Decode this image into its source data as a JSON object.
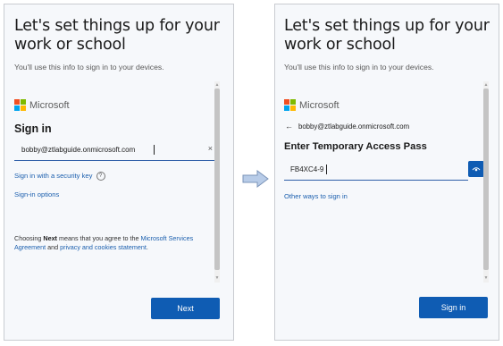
{
  "left_screen": {
    "heading_line1": "Let's set things up for your",
    "heading_line2": "work or school",
    "subtitle": "You'll use this info to sign in to your devices.",
    "brand": "Microsoft",
    "signin_title": "Sign in",
    "email_value": "bobby@ztlabguide.onmicrosoft.com",
    "clear_icon": "×",
    "security_key_link": "Sign in with a security key",
    "help_icon": "?",
    "signin_options_link": "Sign-in options",
    "terms_prefix": "Choosing ",
    "terms_bold": "Next",
    "terms_middle": " means that you agree to the ",
    "terms_link1": "Microsoft Services Agreement",
    "terms_and": " and ",
    "terms_link2": "privacy and cookies statement",
    "terms_end": ".",
    "next_button": "Next"
  },
  "right_screen": {
    "heading_line1": "Let's set things up for your",
    "heading_line2": "work or school",
    "subtitle": "You'll use this info to sign in to your devices.",
    "brand": "Microsoft",
    "back_arrow": "←",
    "account": "bobby@ztlabguide.onmicrosoft.com",
    "tap_title": "Enter Temporary Access Pass",
    "tap_value": "FB4XC4-9",
    "other_ways_link": "Other ways to sign in",
    "signin_button": "Sign in"
  },
  "colors": {
    "accent": "#0f5cb3",
    "link": "#1b5fae",
    "ms_red": "#f25022",
    "ms_green": "#7fba00",
    "ms_blue": "#00a4ef",
    "ms_yellow": "#ffb900"
  }
}
